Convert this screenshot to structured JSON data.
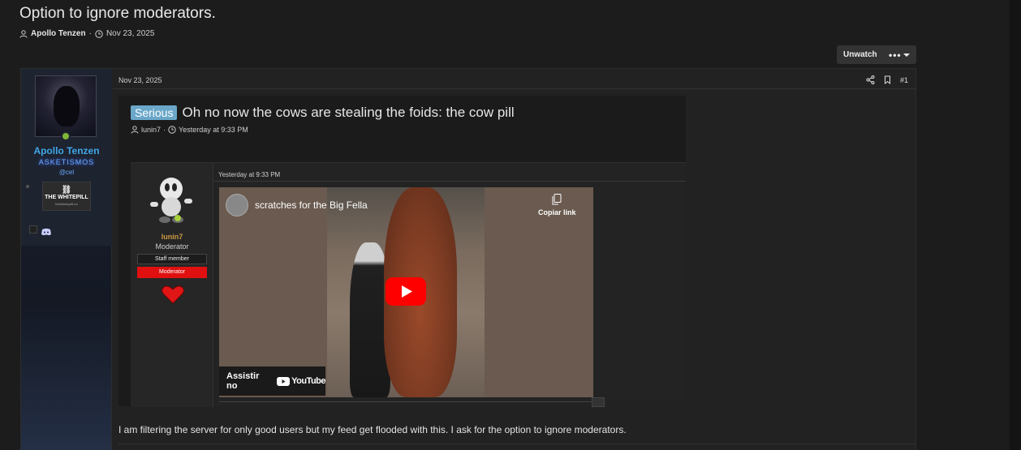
{
  "thread": {
    "title": "Option to ignore moderators.",
    "author": "Apollo Tenzen",
    "separator": "·",
    "date": "Nov 23, 2025"
  },
  "toolbar": {
    "unwatch_label": "Unwatch",
    "more_label": "•••"
  },
  "post": {
    "date": "Nov 23, 2025",
    "number": "#1",
    "user": {
      "name": "Apollo Tenzen",
      "title": "ASKETISMOS",
      "subtitle": "@cel",
      "badge_label": "THE WHITEPILL",
      "badge_small": "theblackpill.co"
    },
    "body": "I am filtering the server for only good users but my feed get flooded with this. I ask for the option to ignore moderators.",
    "embed": {
      "prefix": "Serious",
      "title": "Oh no now the cows are stealing the foids: the cow pill",
      "author": "lunin7",
      "separator": "·",
      "time": "Yesterday at 9:33 PM",
      "inner_post": {
        "time": "Yesterday at 9:33 PM",
        "user_name": "lunin7",
        "role": "Moderator",
        "staff_label": "Staff member",
        "mod_label": "Moderator"
      },
      "video": {
        "title": "scratches for the Big Fella",
        "copy_label": "Copiar link",
        "watch_on": "Assistir no",
        "brand": "YouTube"
      }
    }
  },
  "colors": {
    "background": "#1c1c1c",
    "username_blue": "#3fa7e8",
    "prefix_blue": "#6aa7c9",
    "mod_red": "#e01010",
    "online_green": "#7fb539"
  },
  "icons": {
    "user": "user-icon",
    "clock": "clock-icon",
    "share": "share-icon",
    "bookmark": "bookmark-icon",
    "link": "link-icon",
    "discord": "discord-icon",
    "copy": "copy-icon",
    "play": "play-icon",
    "heart": "heart-icon"
  }
}
